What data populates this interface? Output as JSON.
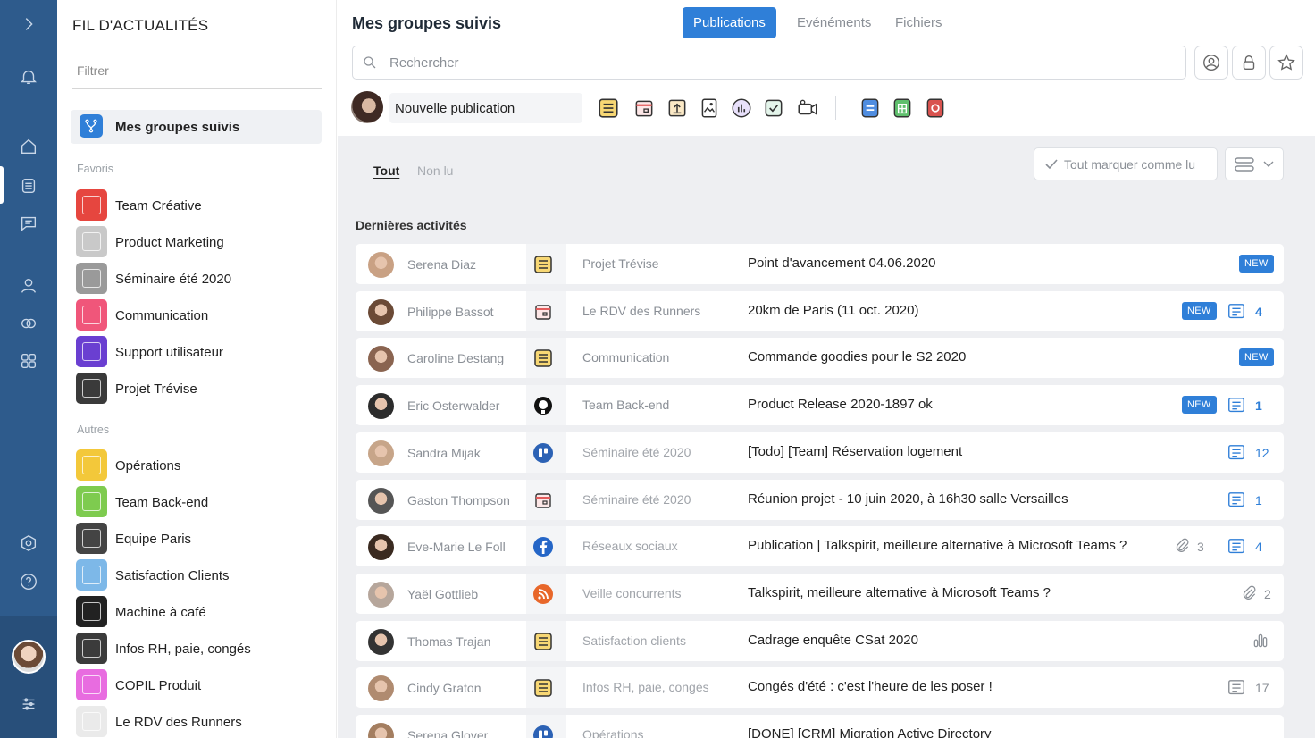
{
  "sidebar": {
    "title": "FIL D'ACTUALITÉS",
    "filter_placeholder": "Filtrer",
    "active_item": "Mes groupes suivis",
    "favoris_label": "Favoris",
    "autres_label": "Autres",
    "favoris": [
      {
        "label": "Team Créative",
        "color": "#e6463f"
      },
      {
        "label": "Product Marketing",
        "color": "#c9c9c9"
      },
      {
        "label": "Séminaire été 2020",
        "color": "#9a9a9a"
      },
      {
        "label": "Communication",
        "color": "#f0567a"
      },
      {
        "label": "Support utilisateur",
        "color": "#6a3fd1"
      },
      {
        "label": "Projet Trévise",
        "color": "#3a3a3a"
      }
    ],
    "autres": [
      {
        "label": "Opérations",
        "color": "#f3c83a"
      },
      {
        "label": "Team Back-end",
        "color": "#7ecb4f"
      },
      {
        "label": "Equipe Paris",
        "color": "#444"
      },
      {
        "label": "Satisfaction Clients",
        "color": "#7db8e8"
      },
      {
        "label": "Machine à café",
        "color": "#222"
      },
      {
        "label": "Infos RH, paie, congés",
        "color": "#3b3b3b"
      },
      {
        "label": "COPIL Produit",
        "color": "#e86ce0"
      },
      {
        "label": "Le RDV des Runners",
        "color": "#eaeaea"
      }
    ]
  },
  "header": {
    "title": "Mes groupes suivis",
    "tabs": [
      "Publications",
      "Evénéments",
      "Fichiers"
    ],
    "search_placeholder": "Rechercher",
    "new_post": "Nouvelle publication"
  },
  "filters": {
    "all": "Tout",
    "unread": "Non lu"
  },
  "mark_all_read": "Tout marquer comme lu",
  "section_title": "Dernières activités",
  "new_badge": "NEW",
  "feed": [
    {
      "name": "Serena Diaz",
      "type": "post-icon",
      "group": "Projet Trévise",
      "title": "Point d'avancement 04.06.2020",
      "new": true,
      "comments": "",
      "attachments": ""
    },
    {
      "name": "Philippe Bassot",
      "type": "calendar-icon",
      "group": "Le RDV des Runners",
      "title": "20km de Paris (11 oct. 2020)",
      "new": true,
      "comments": "4",
      "attachments": ""
    },
    {
      "name": "Caroline Destang",
      "type": "post-icon",
      "group": "Communication",
      "title": "Commande goodies pour le S2 2020",
      "new": true,
      "comments": "",
      "attachments": ""
    },
    {
      "name": "Eric Osterwalder",
      "type": "github-icon",
      "group": "Team Back-end",
      "title": "Product Release 2020-1897 ok",
      "new": true,
      "comments": "1",
      "attachments": ""
    },
    {
      "name": "Sandra Mijak",
      "type": "trello-icon",
      "group": "Séminaire été 2020",
      "title": "[Todo] [Team] Réservation logement",
      "new": false,
      "comments": "12",
      "attachments": ""
    },
    {
      "name": "Gaston Thompson",
      "type": "calendar-icon",
      "group": "Séminaire été 2020",
      "title": "Réunion projet - 10 juin 2020, à 16h30 salle Versailles",
      "new": false,
      "comments": "1",
      "attachments": ""
    },
    {
      "name": "Eve-Marie Le Foll",
      "type": "facebook-icon",
      "group": "Réseaux sociaux",
      "title": "Publication | Talkspirit, meilleure alternative à Microsoft Teams ?",
      "new": false,
      "comments": "4",
      "attachments": "3"
    },
    {
      "name": "Yaël Gottlieb",
      "type": "rss-icon",
      "group": "Veille concurrents",
      "title": "Talkspirit, meilleure alternative à Microsoft Teams ?",
      "new": false,
      "comments": "",
      "attachments": "2"
    },
    {
      "name": "Thomas Trajan",
      "type": "post-icon",
      "group": "Satisfaction clients",
      "title": "Cadrage enquête CSat 2020",
      "new": false,
      "comments": "",
      "attachments": ""
    },
    {
      "name": "Cindy Graton",
      "type": "post-icon",
      "group": "Infos RH, paie, congés",
      "title": "Congés d'été : c'est l'heure de les poser !",
      "new": false,
      "comments": "17",
      "attachments": ""
    },
    {
      "name": "Serena Glover",
      "type": "trello-icon",
      "group": "Opérations",
      "title": "[DONE] [CRM] Migration Active Directory",
      "new": false,
      "comments": "",
      "attachments": ""
    }
  ]
}
